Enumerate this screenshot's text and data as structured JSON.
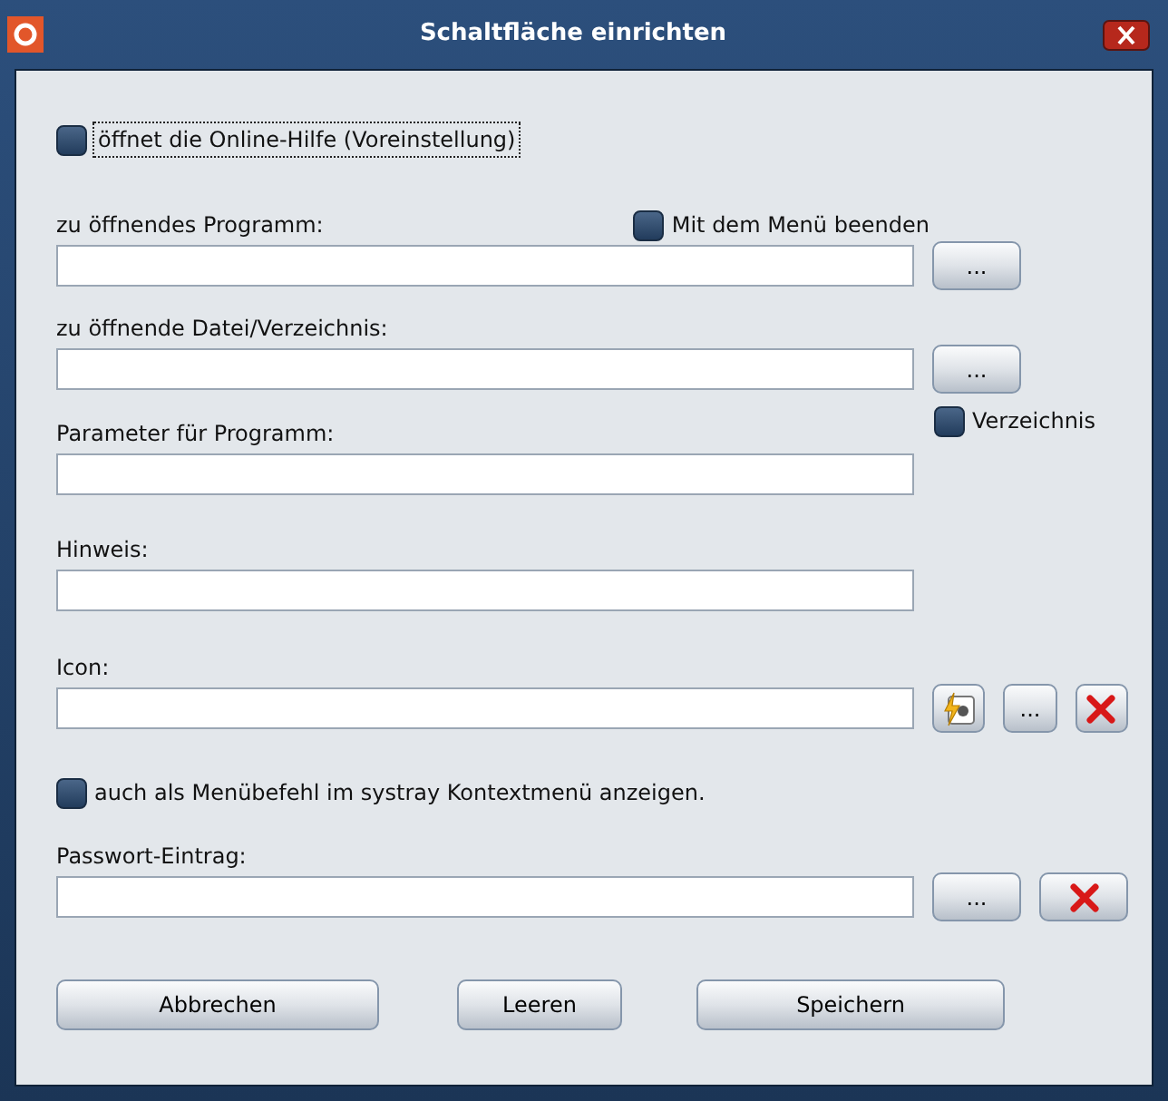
{
  "window": {
    "title": "Schaltfläche einrichten"
  },
  "rows": [
    {
      "kind": "checkbox",
      "label": "öffnet die Online-Hilfe (Voreinstellung)",
      "checked": false,
      "focused": true
    },
    {
      "kind": "field",
      "label": "zu öffnendes Programm:",
      "buttons": [
        {
          "kind": "browse",
          "label": "..."
        }
      ],
      "option": {
        "kind": "inline",
        "label": "Mit dem Menü beenden",
        "checked": false
      }
    },
    {
      "kind": "field",
      "label": "zu öffnende Datei/Verzeichnis:",
      "buttons": [
        {
          "kind": "browse",
          "label": "..."
        }
      ],
      "option": {
        "kind": "below",
        "label": "Verzeichnis",
        "checked": false
      }
    },
    {
      "kind": "field",
      "label": "Parameter für Programm:"
    },
    {
      "kind": "field",
      "label": "Hinweis:"
    },
    {
      "kind": "field",
      "label": "Icon:",
      "buttons": [
        {
          "kind": "image"
        },
        {
          "kind": "browse",
          "label": "..."
        },
        {
          "kind": "clear"
        }
      ]
    },
    {
      "kind": "checkbox",
      "label": "auch als Menübefehl im systray Kontextmenü anzeigen.",
      "checked": false,
      "focused": false
    },
    {
      "kind": "field",
      "label": "Passwort-Eintrag:",
      "buttons": [
        {
          "kind": "browse",
          "label": "..."
        },
        {
          "kind": "clear"
        }
      ]
    }
  ],
  "actions": [
    {
      "label": "Abbrechen",
      "kind": "cancel"
    },
    {
      "label": "Leeren",
      "kind": "clear"
    },
    {
      "label": "Speichern",
      "kind": "save"
    }
  ]
}
